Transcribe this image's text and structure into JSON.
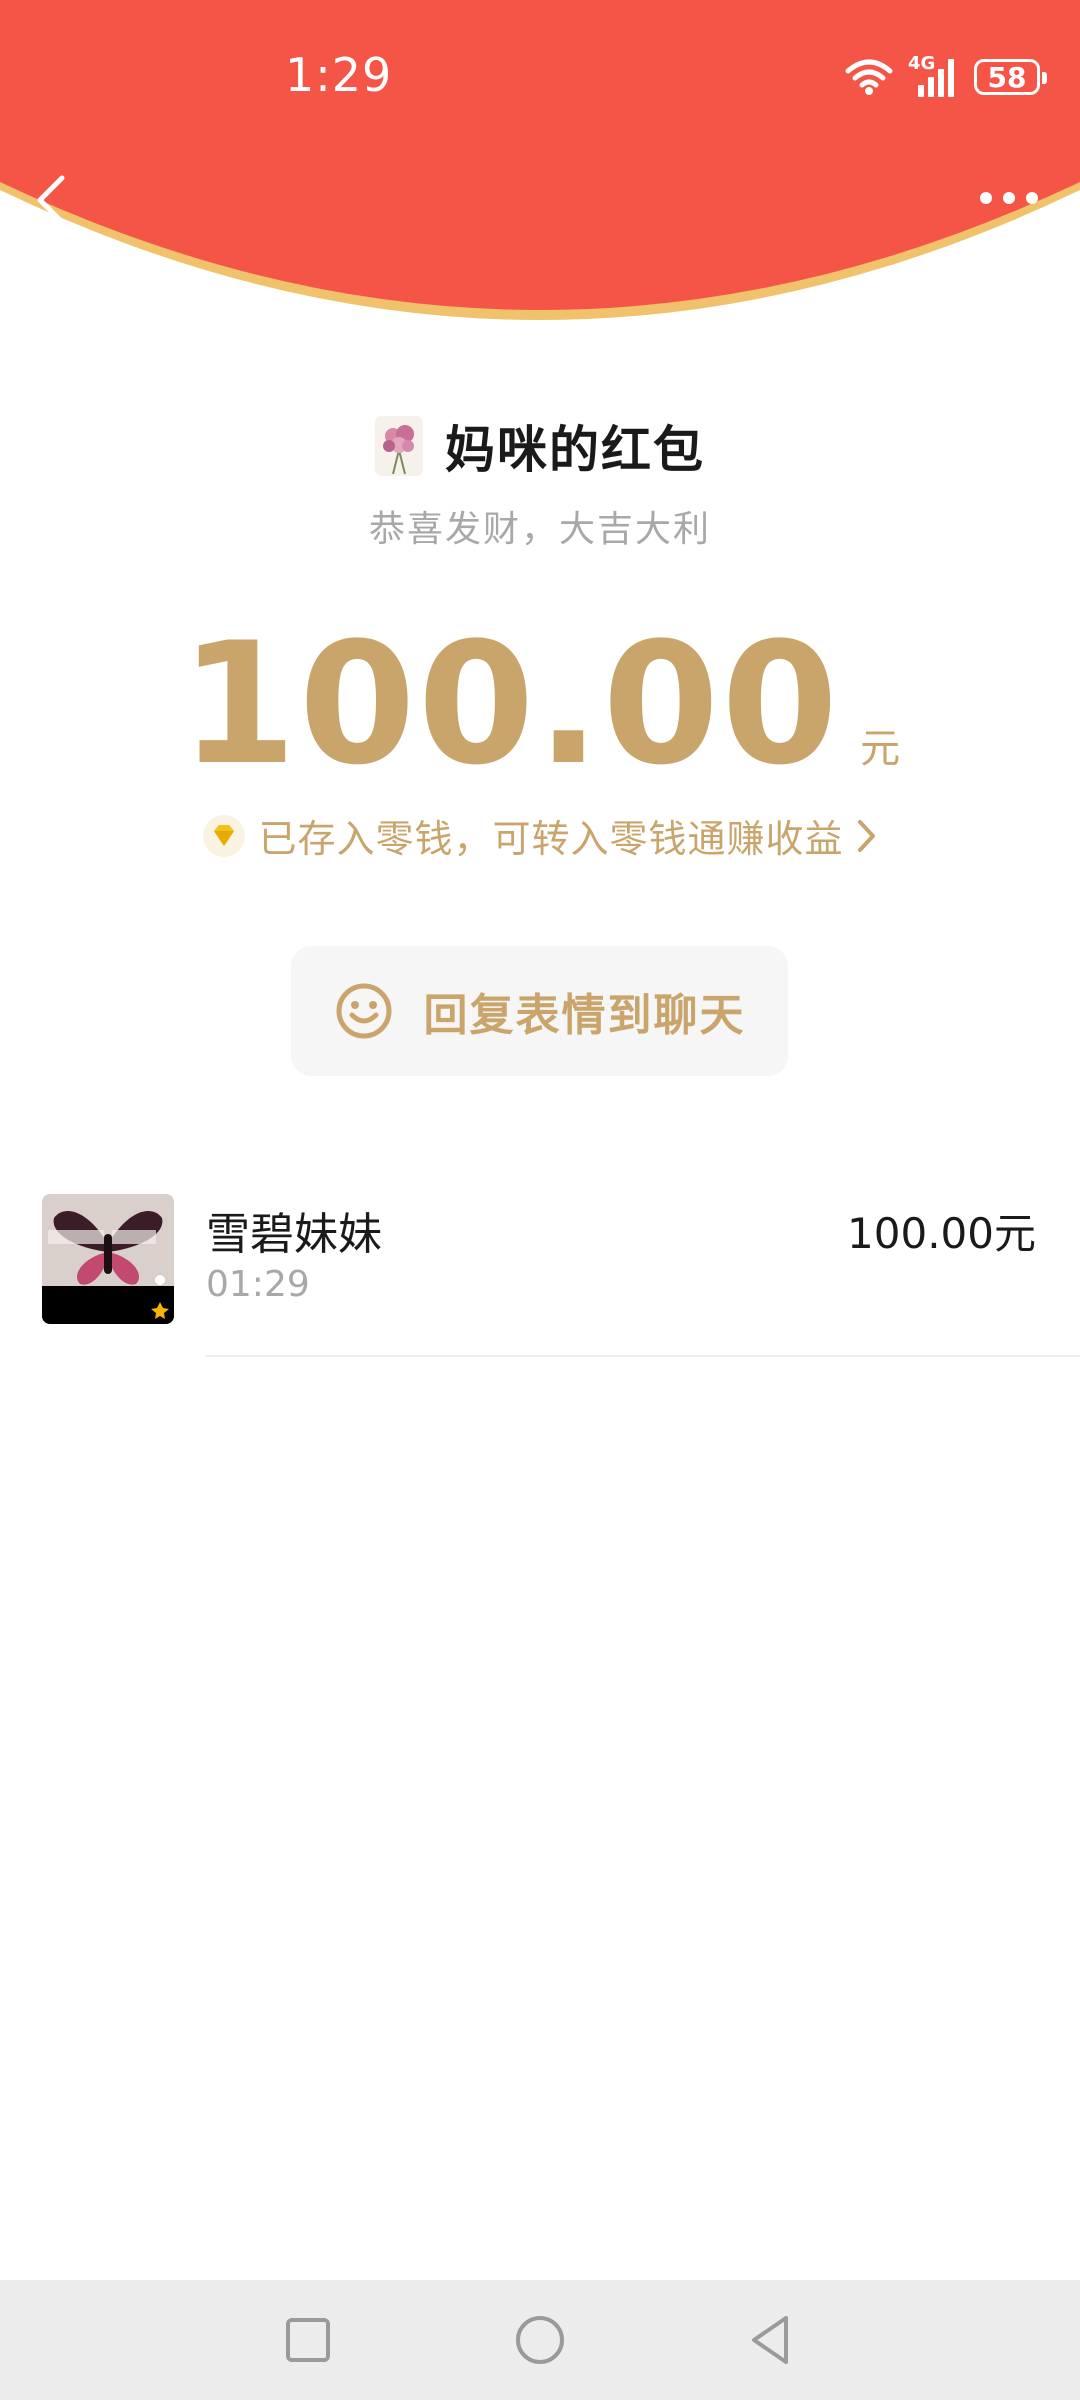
{
  "colors": {
    "header_red": "#f55547",
    "header_rim": "#f0c26b",
    "gold": "#c9a56c",
    "text_dark": "#1a1a1a",
    "text_gray": "#a8a8a8",
    "nav_bg": "#ececec"
  },
  "status_bar": {
    "time": "1:29",
    "network": "4G",
    "battery": "58",
    "icons": [
      "wifi-icon",
      "signal-icon",
      "battery-icon"
    ]
  },
  "header": {
    "back_icon": "chevron-left-icon",
    "more_icon": "more-dots-icon"
  },
  "red_packet": {
    "sender_name": "妈咪的红包",
    "greeting": "恭喜发财，大吉大利",
    "amount": "100.00",
    "amount_unit": "元",
    "note_icon": "diamond-icon",
    "note": "已存入零钱，可转入零钱通赚收益",
    "note_arrow_icon": "chevron-right-icon",
    "reply_icon": "smile-icon",
    "reply_label": "回复表情到聊天"
  },
  "receivers": [
    {
      "name": "雪碧妹妹",
      "time": "01:29",
      "amount": "100.00元"
    }
  ],
  "nav_bar": {
    "buttons": [
      "recent-apps-icon",
      "home-icon",
      "back-icon"
    ]
  }
}
